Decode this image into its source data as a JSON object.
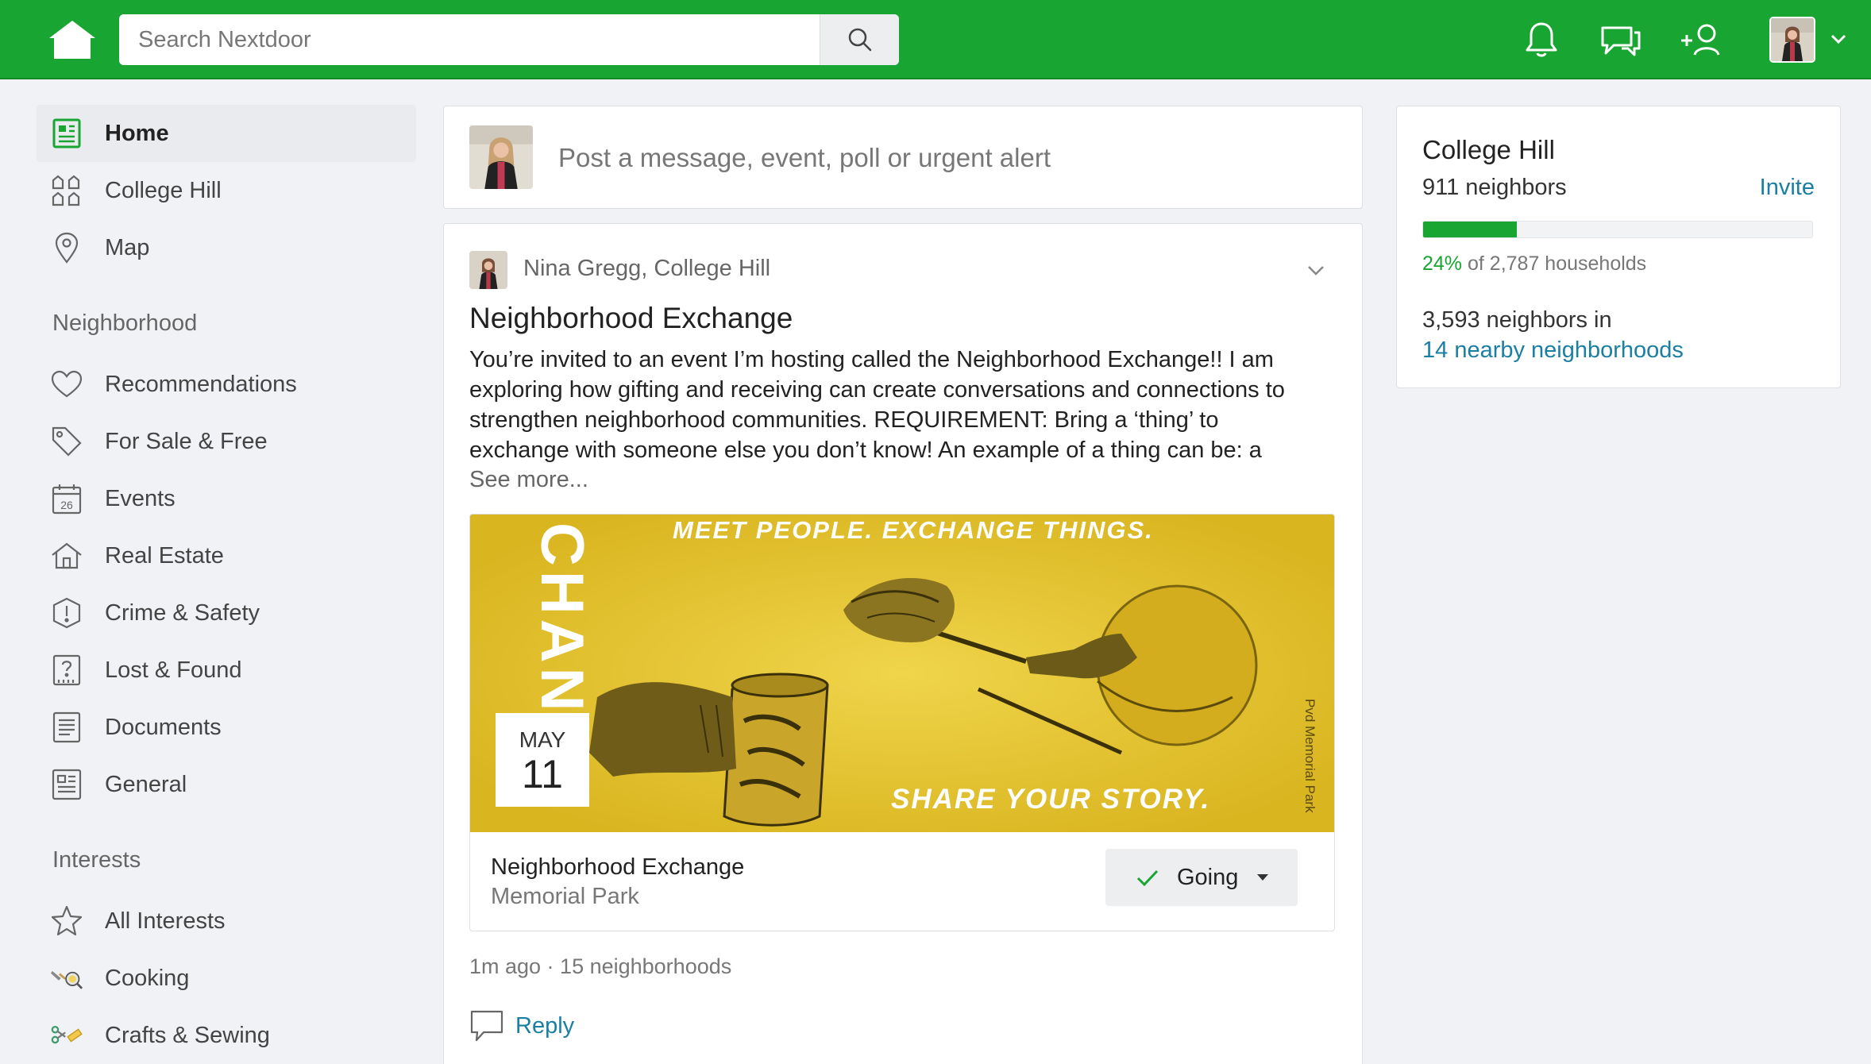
{
  "header": {
    "logo_icon": "home-icon",
    "search": {
      "placeholder": "Search Nextdoor",
      "value": ""
    },
    "icons": [
      "bell-icon",
      "chat-bubbles-icon",
      "add-neighbor-icon"
    ],
    "brand_color": "#19a532"
  },
  "sidebar": {
    "main": [
      {
        "label": "Home",
        "icon": "newsfeed-icon",
        "active": true
      },
      {
        "label": "College Hill",
        "icon": "houses-icon"
      },
      {
        "label": "Map",
        "icon": "map-pin-icon"
      }
    ],
    "neighborhood_heading": "Neighborhood",
    "neighborhood": [
      {
        "label": "Recommendations",
        "icon": "heart-icon"
      },
      {
        "label": "For Sale & Free",
        "icon": "tag-icon"
      },
      {
        "label": "Events",
        "icon": "calendar-icon",
        "icon_text": "26"
      },
      {
        "label": "Real Estate",
        "icon": "house-icon"
      },
      {
        "label": "Crime & Safety",
        "icon": "warning-shield-icon"
      },
      {
        "label": "Lost & Found",
        "icon": "question-card-icon"
      },
      {
        "label": "Documents",
        "icon": "document-icon"
      },
      {
        "label": "General",
        "icon": "general-icon"
      }
    ],
    "interests_heading": "Interests",
    "interests": [
      {
        "label": "All Interests",
        "icon": "star-icon"
      },
      {
        "label": "Cooking",
        "icon": "cooking-icon"
      },
      {
        "label": "Crafts & Sewing",
        "icon": "scissors-icon"
      }
    ]
  },
  "composer": {
    "prompt": "Post a message, event, poll or urgent alert"
  },
  "post": {
    "author": "Nina Gregg, College Hill",
    "title": "Neighborhood Exchange",
    "body": "You’re invited to an event I’m hosting called the Neighborhood Exchange!! I am exploring how gifting and receiving can create conversations and connections to strengthen neighborhood communities. REQUIREMENT: Bring a ‘thing’ to exchange with someone else you don’t know! An example of a thing can be: a",
    "see_more": "See more...",
    "event": {
      "image_text_top": "MEET PEOPLE.  EXCHANGE THINGS.",
      "image_text_bottom": "SHARE YOUR STORY.",
      "image_text_side": "CHANG",
      "image_text_right": "Pvd Memorial Park",
      "month": "MAY",
      "day": "11",
      "name": "Neighborhood Exchange",
      "place": "Memorial Park",
      "rsvp_label": "Going"
    },
    "meta": "1m ago · 15 neighborhoods",
    "reply_label": "Reply"
  },
  "neighborhood_card": {
    "title": "College Hill",
    "neighbors": "911 neighbors",
    "invite_label": "Invite",
    "progress_fraction": 0.24,
    "percent": "24%",
    "households_text": " of 2,787 households",
    "nearby_text": "3,593 neighbors in",
    "nearby_link": "14 nearby neighborhoods"
  }
}
